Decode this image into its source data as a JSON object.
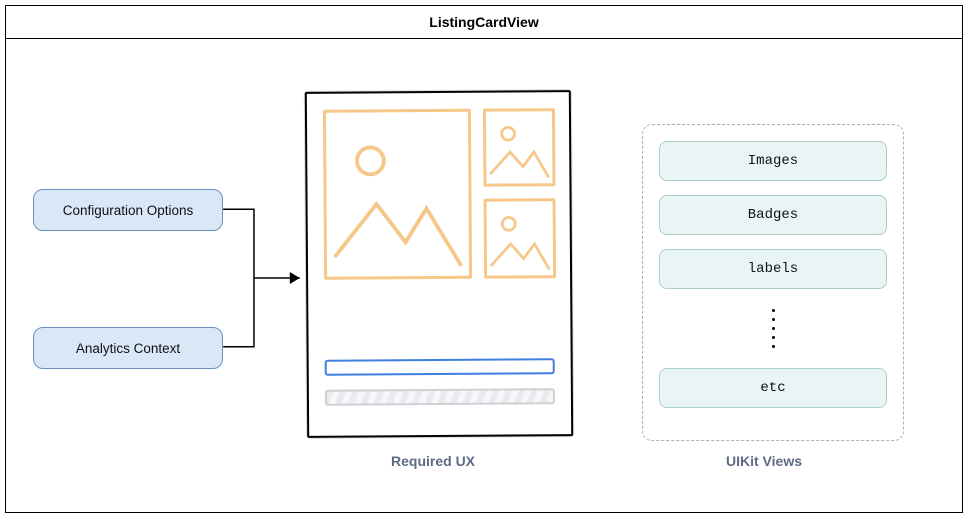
{
  "header": {
    "title": "ListingCardView"
  },
  "inputs": {
    "config": "Configuration Options",
    "analytics": "Analytics Context"
  },
  "captions": {
    "required_ux": "Required UX",
    "uikit_views": "UIKit Views"
  },
  "uikit": {
    "items": [
      "Images",
      "Badges",
      "labels",
      "etc"
    ]
  },
  "colors": {
    "pill_bg": "#d9e7f7",
    "pill_border": "#6a8fb8",
    "wireframe_stroke": "#000000",
    "image_placeholder_stroke": "#f5c88a",
    "blue_bar_stroke": "#3f7fdf",
    "gray_bar_stroke": "#cfcfd6",
    "uikit_item_bg": "#e9f5f5",
    "uikit_item_border": "#a9cfcf",
    "panel_dash": "#a5b1bd",
    "caption": "#5e6b85"
  }
}
